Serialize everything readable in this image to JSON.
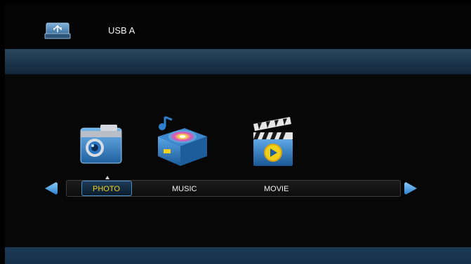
{
  "header": {
    "device_label": "USB A",
    "device_icon": "usb-drive-icon"
  },
  "menu": {
    "selected_index": 0,
    "items": [
      {
        "label": "PHOTO",
        "icon": "camera-icon"
      },
      {
        "label": "MUSIC",
        "icon": "music-box-icon"
      },
      {
        "label": "MOVIE",
        "icon": "clapperboard-icon"
      }
    ]
  },
  "colors": {
    "accent_text": "#f2d019",
    "band_blue": "#1b3348",
    "arrow_blue": "#3a95e4",
    "background": "#070707"
  },
  "nav": {
    "left_icon": "arrow-left-icon",
    "right_icon": "arrow-right-icon"
  }
}
